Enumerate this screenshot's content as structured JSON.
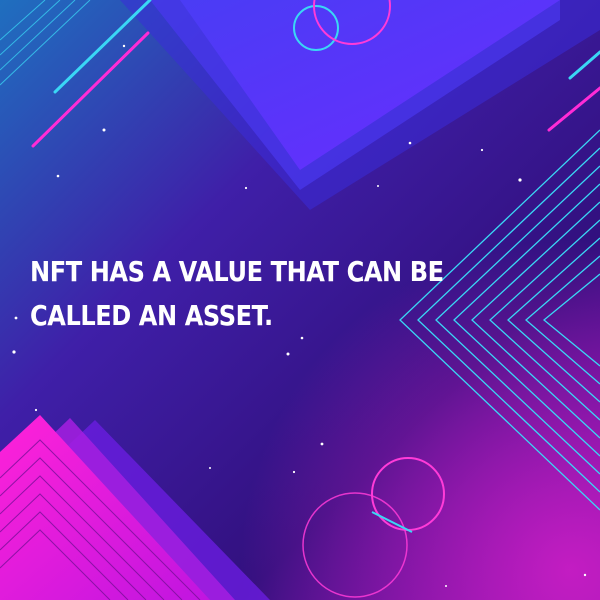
{
  "headline": {
    "text": "NFT HAS A VALUE THAT CAN BE CALLED AN ASSET."
  },
  "colors": {
    "text": "#ffffff",
    "background_top_left": "#1f63b8",
    "background_center": "#3a0f8f",
    "background_bottom_right": "#7a0fa8",
    "neon_cyan": "#3ad7f5",
    "neon_magenta": "#ff2bd6",
    "panel_violet": "#5a34f0",
    "hot_pink": "#ff1fd1"
  }
}
